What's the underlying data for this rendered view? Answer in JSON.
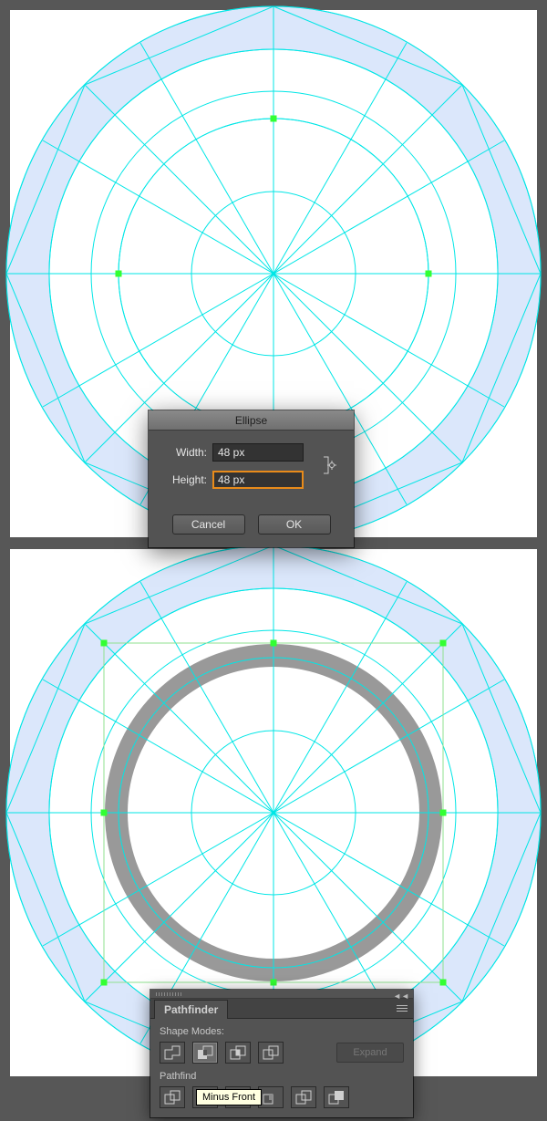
{
  "ellipse_dialog": {
    "title": "Ellipse",
    "width_label": "Width:",
    "height_label": "Height:",
    "width_value": "48 px",
    "height_value": "48 px",
    "cancel_label": "Cancel",
    "ok_label": "OK"
  },
  "pathfinder_panel": {
    "tab_label": "Pathfinder",
    "shape_modes_label": "Shape Modes:",
    "pathfinders_label": "Pathfind",
    "expand_label": "Expand",
    "tooltip": "Minus Front"
  }
}
